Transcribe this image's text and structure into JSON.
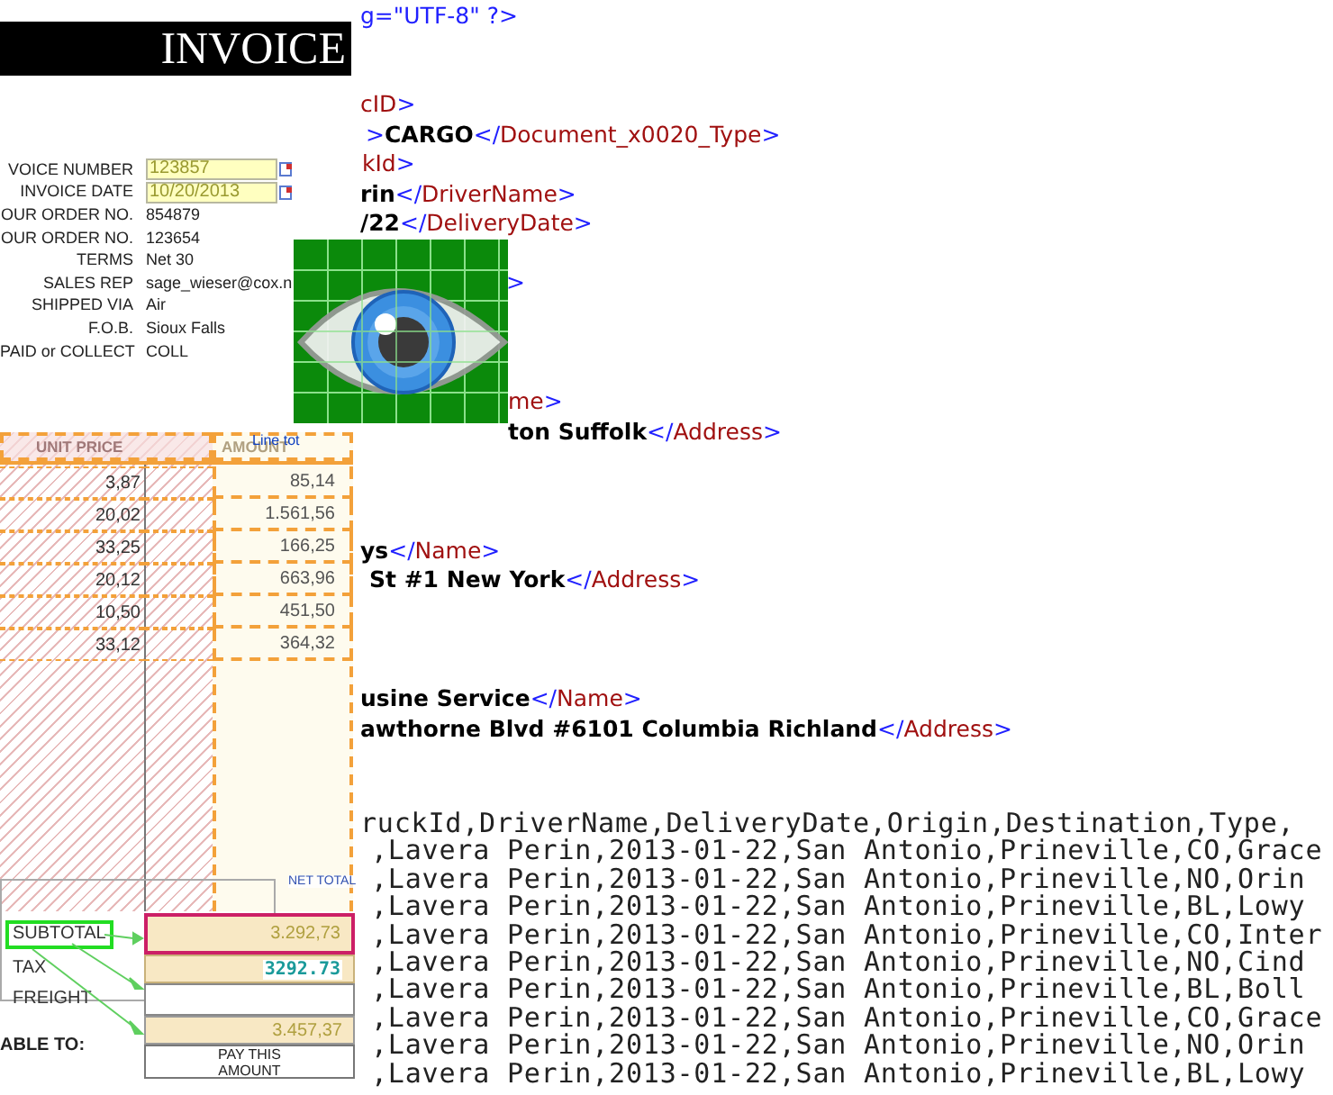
{
  "invoice": {
    "title": "INVOICE",
    "fields": [
      {
        "label": "VOICE NUMBER",
        "value": "123857",
        "kind": "input"
      },
      {
        "label": "INVOICE DATE",
        "value": "10/20/2013",
        "kind": "input"
      },
      {
        "label": "OUR ORDER NO.",
        "value": "854879",
        "kind": "text"
      },
      {
        "label": "OUR ORDER NO.",
        "value": "123654",
        "kind": "text"
      },
      {
        "label": "TERMS",
        "value": "Net 30",
        "kind": "text"
      },
      {
        "label": "SALES REP",
        "value": "sage_wieser@cox.n",
        "kind": "text"
      },
      {
        "label": "SHIPPED VIA",
        "value": "Air",
        "kind": "text"
      },
      {
        "label": "F.O.B.",
        "value": "Sioux Falls",
        "kind": "text"
      },
      {
        "label": "PAID or COLLECT",
        "value": "COLL",
        "kind": "text"
      }
    ],
    "table": {
      "columns": [
        "UNIT PRICE",
        "AMOUNT"
      ],
      "hint": "Line tot",
      "rows": [
        {
          "unit_price": "3,87",
          "amount": "85,14"
        },
        {
          "unit_price": "20,02",
          "amount": "1.561,56"
        },
        {
          "unit_price": "33,25",
          "amount": "166,25"
        },
        {
          "unit_price": "20,12",
          "amount": "663,96"
        },
        {
          "unit_price": "10,50",
          "amount": "451,50"
        },
        {
          "unit_price": "33,12",
          "amount": "364,32"
        }
      ]
    },
    "totals": {
      "net_total_label": "NET TOTAL",
      "rows": [
        {
          "label": "SUBTOTAL",
          "value": "3.292,73",
          "kind": "amount",
          "selected": true
        },
        {
          "label": "TAX",
          "value": "3292.73",
          "kind": "preview",
          "selected": false
        },
        {
          "label": "FREIGHT",
          "kind": "amount",
          "selected": false
        }
      ],
      "grand_total": "3.457,37",
      "pay_caption": [
        "PAY THIS",
        "AMOUNT"
      ],
      "payable_label": "ABLE TO:"
    }
  },
  "xml_lines": [
    {
      "parts": [
        {
          "kind": "punct",
          "text": "g=\"UTF-8\" ?>"
        }
      ]
    },
    {
      "parts": [
        {
          "kind": "tag",
          "text": "cID"
        },
        {
          "kind": "punct",
          "text": ">"
        }
      ]
    },
    {
      "parts": [
        {
          "kind": "punct",
          "text": ">"
        },
        {
          "kind": "value",
          "text": "CARGO"
        },
        {
          "kind": "punct",
          "text": "</"
        },
        {
          "kind": "tag",
          "text": "Document_x0020_Type"
        },
        {
          "kind": "punct",
          "text": ">"
        }
      ]
    },
    {
      "parts": [
        {
          "kind": "tag",
          "text": "kId"
        },
        {
          "kind": "punct",
          "text": ">"
        }
      ]
    },
    {
      "parts": [
        {
          "kind": "value",
          "text": "rin"
        },
        {
          "kind": "punct",
          "text": "</"
        },
        {
          "kind": "tag",
          "text": "DriverName"
        },
        {
          "kind": "punct",
          "text": ">"
        }
      ]
    },
    {
      "parts": [
        {
          "kind": "value",
          "text": "/22"
        },
        {
          "kind": "punct",
          "text": "</"
        },
        {
          "kind": "tag",
          "text": "DeliveryDate"
        },
        {
          "kind": "punct",
          "text": ">"
        }
      ]
    },
    {
      "parts": [
        {
          "kind": "punct",
          "text": ">"
        }
      ]
    },
    {
      "parts": [
        {
          "kind": "tag",
          "text": "me"
        },
        {
          "kind": "punct",
          "text": ">"
        }
      ]
    },
    {
      "parts": [
        {
          "kind": "value",
          "text": "ton Suffolk"
        },
        {
          "kind": "punct",
          "text": "</"
        },
        {
          "kind": "tag",
          "text": "Address"
        },
        {
          "kind": "punct",
          "text": ">"
        }
      ]
    },
    {
      "parts": [
        {
          "kind": "value",
          "text": "ys"
        },
        {
          "kind": "punct",
          "text": "</"
        },
        {
          "kind": "tag",
          "text": "Name"
        },
        {
          "kind": "punct",
          "text": ">"
        }
      ]
    },
    {
      "parts": [
        {
          "kind": "value",
          "text": "St #1 New York"
        },
        {
          "kind": "punct",
          "text": "</"
        },
        {
          "kind": "tag",
          "text": "Address"
        },
        {
          "kind": "punct",
          "text": ">"
        }
      ]
    },
    {
      "parts": [
        {
          "kind": "value",
          "text": "usine Service"
        },
        {
          "kind": "punct",
          "text": "</"
        },
        {
          "kind": "tag",
          "text": "Name"
        },
        {
          "kind": "punct",
          "text": ">"
        }
      ]
    },
    {
      "parts": [
        {
          "kind": "value",
          "text": "awthorne Blvd #6101 Columbia Richland"
        },
        {
          "kind": "punct",
          "text": "</"
        },
        {
          "kind": "tag",
          "text": "Address"
        },
        {
          "kind": "punct",
          "text": ">"
        }
      ]
    }
  ],
  "csv_lines": [
    "ruckId,DriverName,DeliveryDate,Origin,Destination,Type,",
    ",Lavera Perin,2013-01-22,San Antonio,Prineville,CO,Grace",
    ",Lavera Perin,2013-01-22,San Antonio,Prineville,NO,Orin",
    ",Lavera Perin,2013-01-22,San Antonio,Prineville,BL,Lowy",
    ",Lavera Perin,2013-01-22,San Antonio,Prineville,CO,Inter",
    ",Lavera Perin,2013-01-22,San Antonio,Prineville,NO,Cind",
    ",Lavera Perin,2013-01-22,San Antonio,Prineville,BL,Boll",
    ",Lavera Perin,2013-01-22,San Antonio,Prineville,CO,Grace",
    ",Lavera Perin,2013-01-22,San Antonio,Prineville,NO,Orin",
    ",Lavera Perin,2013-01-22,San Antonio,Prineville,BL,Lowy"
  ]
}
